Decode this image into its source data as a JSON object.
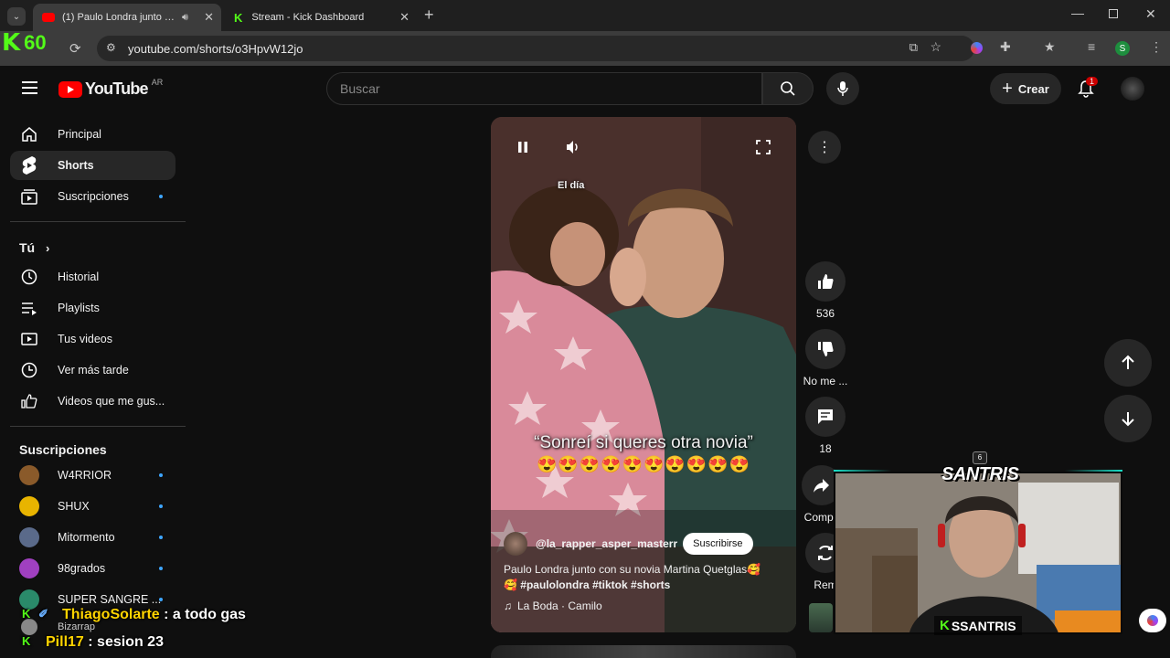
{
  "browser": {
    "tabs": [
      {
        "title": "(1) Paulo Londra junto con su no",
        "active": true
      },
      {
        "title": "Stream - Kick Dashboard",
        "active": false
      }
    ],
    "url": "youtube.com/shorts/o3HpvW12jo",
    "profile_initial": "S"
  },
  "overlay": {
    "kick_counter": "60",
    "streamer_name": "SSANTRIS",
    "brand": "SANTRIS",
    "chat": [
      {
        "user": "ThiagoSolarte",
        "message": ": a todo gas"
      },
      {
        "user": "Pill17",
        "message": ": sesion 23"
      }
    ]
  },
  "header": {
    "logo": "YouTube",
    "region": "AR",
    "search_placeholder": "Buscar",
    "create_label": "Crear",
    "notification_count": "1"
  },
  "sidebar": {
    "main": [
      {
        "label": "Principal",
        "icon": "home-icon"
      },
      {
        "label": "Shorts",
        "icon": "shorts-icon",
        "active": true
      },
      {
        "label": "Suscripciones",
        "icon": "subscriptions-icon",
        "dot": true
      }
    ],
    "you_label": "Tú",
    "you": [
      {
        "label": "Historial",
        "icon": "history-icon"
      },
      {
        "label": "Playlists",
        "icon": "playlists-icon"
      },
      {
        "label": "Tus videos",
        "icon": "your-videos-icon"
      },
      {
        "label": "Ver más tarde",
        "icon": "watch-later-icon"
      },
      {
        "label": "Videos que me gus...",
        "icon": "liked-icon"
      }
    ],
    "subs_label": "Suscripciones",
    "subs": [
      {
        "label": "W4RRIOR",
        "color": "#8a5a2a"
      },
      {
        "label": "SHUX",
        "color": "#e8b400"
      },
      {
        "label": "Mitormento",
        "color": "#5a6a8a"
      },
      {
        "label": "98grados",
        "color": "#a040c0"
      },
      {
        "label": "SUPER SANGRE ...",
        "color": "#2a8a6a"
      },
      {
        "label": "Bizarrap",
        "color": "#888888"
      }
    ]
  },
  "short": {
    "caption_top": "El día",
    "overlay_text": "“Sonreí si queres otra novia”",
    "emojis": "😍😍😍😍😍😍😍😍😍😍",
    "channel": "@la_rapper_asper_masterr",
    "subscribe_label": "Suscribirse",
    "description": "Paulo Londra junto con su novia Martina Quetglas🥰",
    "hashtags": "🥰 #paulolondra #tiktok #shorts",
    "music": "La Boda · Camilo"
  },
  "actions": {
    "likes": "536",
    "dislike_label": "No me ...",
    "comments": "18",
    "share_label": "Compa",
    "remix_label": "Rem"
  }
}
